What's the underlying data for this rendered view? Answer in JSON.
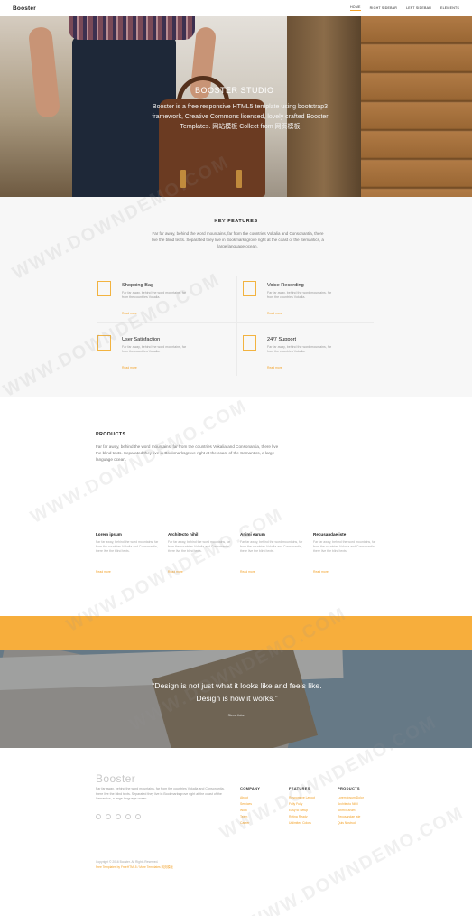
{
  "header": {
    "brand": "Booster",
    "nav": [
      {
        "label": "HOME",
        "active": true
      },
      {
        "label": "RIGHT SIDEBAR",
        "active": false
      },
      {
        "label": "LEFT SIDEBAR",
        "active": false
      },
      {
        "label": "ELEMENTS",
        "active": false
      }
    ]
  },
  "hero": {
    "title": "BOOSTER STUDIO",
    "text": "Booster is a free responsive HTML5 template using bootstrap3 framework, Creative Commons licensed, lovely crafted Booster Templates. 网站模板 Collect from 网页模板",
    "slide_count": 3,
    "active_slide": 0
  },
  "features": {
    "title": "KEY FEATURES",
    "lead": "Far far away, behind the word mountains, far from the countries Vokalia and Consonantia, there live the blind texts. Separated they live in Bookmarksgrove right at the coast of the Semantics, a large language ocean.",
    "items": [
      {
        "title": "Shopping Bag",
        "desc": "Far far away, behind the word mountains, far from the countries Vokalia.",
        "more": "Read more"
      },
      {
        "title": "Voice Recording",
        "desc": "Far far away, behind the word mountains, far from the countries Vokalia.",
        "more": "Read more"
      },
      {
        "title": "User Satisfaction",
        "desc": "Far far away, behind the word mountains, far from the countries Vokalia.",
        "more": "Read more"
      },
      {
        "title": "24/7 Support",
        "desc": "Far far away, behind the word mountains, far from the countries Vokalia.",
        "more": "Read more"
      }
    ]
  },
  "products": {
    "title": "PRODUCTS",
    "lead": "Far far away, behind the word mountains, far from the countries Vokalia and Consonantia, there live the blind texts. Separated they live in Bookmarksgrove right at the coast of the Semantics, a large language ocean.",
    "items": [
      {
        "name": "Lorem ipsum",
        "desc": "Far far away, behind the word mountains, far from the countries Vokalia and Consonantia, there live the blind texts.",
        "more": "Read more"
      },
      {
        "name": "Architecto nihil",
        "desc": "Far far away, behind the word mountains, far from the countries Vokalia and Consonantia, there live the blind texts.",
        "more": "Read more"
      },
      {
        "name": "Animi earum",
        "desc": "Far far away, behind the word mountains, far from the countries Vokalia and Consonantia, there live the blind texts.",
        "more": "Read more"
      },
      {
        "name": "Recusandae iste",
        "desc": "Far far away, behind the word mountains, far from the countries Vokalia and Consonantia, there live the blind texts.",
        "more": "Read more"
      }
    ]
  },
  "quote": {
    "text": "“Design is not just what it looks like and feels like. Design is how it works.”",
    "author": "Steve Jobs"
  },
  "footer": {
    "brand": "Booster",
    "about": "Far far away, behind the word mountains, far from the countries Vokalia and Consonantia, there live the blind texts. Separated they live in Bookmarksgrove right at the coast of the Semantics, a large language ocean.",
    "social_icons": [
      "twitter-icon",
      "facebook-icon",
      "instagram-icon",
      "dribbble-icon",
      "linkedin-icon"
    ],
    "columns": [
      {
        "title": "COMPANY",
        "items": [
          "About",
          "Services",
          "Work",
          "Team",
          "Career"
        ]
      },
      {
        "title": "FEATURES",
        "items": [
          "Responsive Layout",
          "Fully Fully",
          "Easy to Setup",
          "Retina Ready",
          "Unlimited Colors"
        ]
      },
      {
        "title": "PRODUCTS",
        "items": [
          "Lorem Ipsum Dolor",
          "Architecto Nihil",
          "Animi Earum",
          "Recusandae Iste",
          "Quis Nostrud"
        ]
      }
    ],
    "copyright": "Copyright © 2016 Booster. All Rights Reserved.",
    "credit": "Free Templates by FreeHTML5 / More Templates 网页模板"
  },
  "watermark": "WWW.DOWNDEMO.COM"
}
